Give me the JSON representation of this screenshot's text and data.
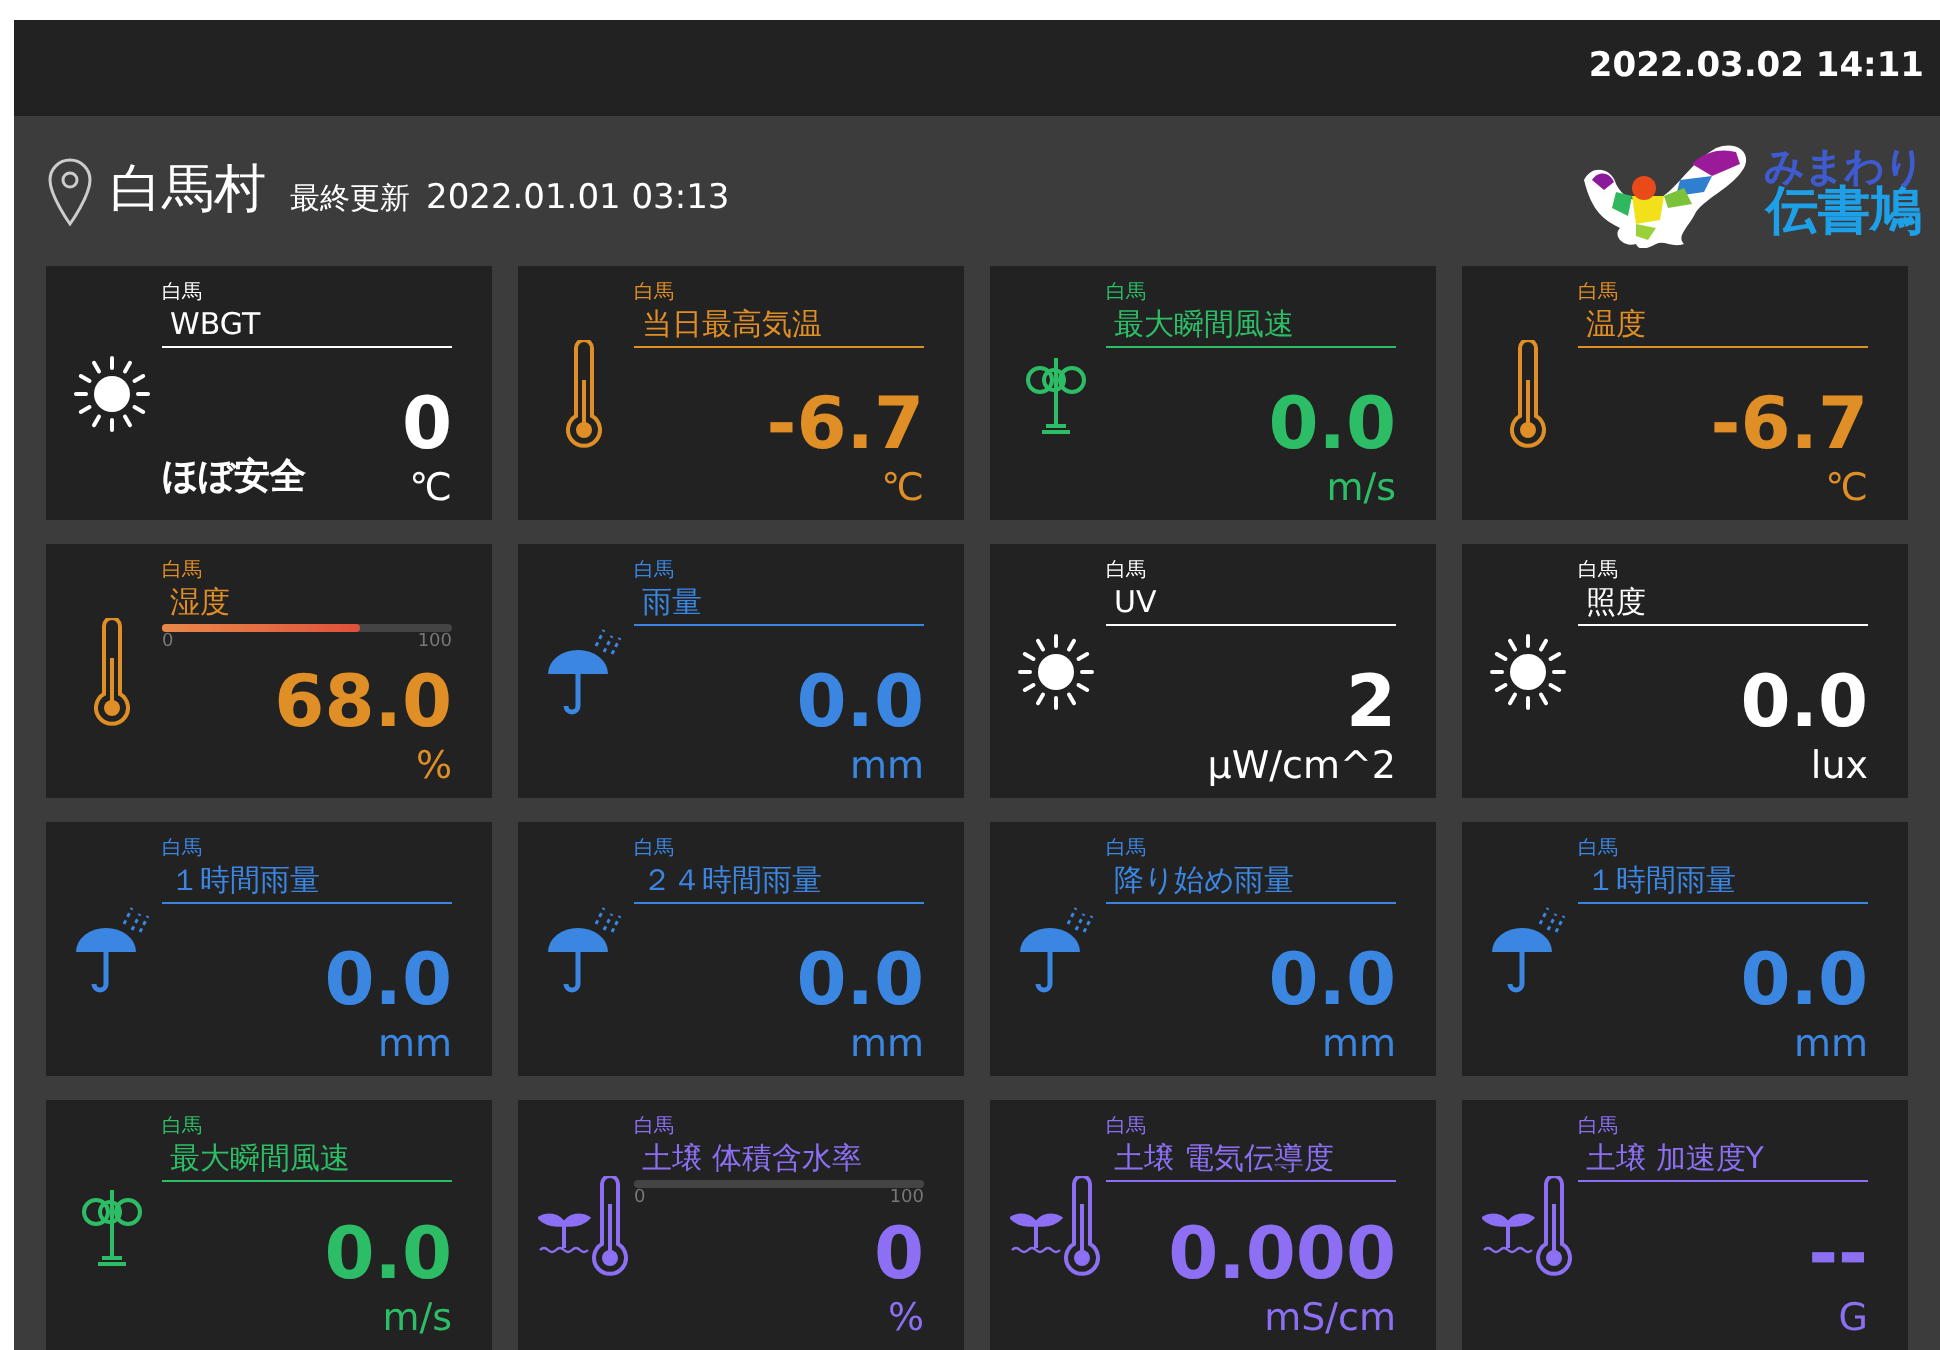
{
  "clock": "2022.03.02 14:11",
  "location": {
    "name": "白馬村",
    "updated_label": "最終更新",
    "updated": "2022.01.01 03:13"
  },
  "logo": {
    "line1": "みまわり",
    "line2": "伝書鳩"
  },
  "cards": [
    {
      "kind": "sun",
      "color": "#ffffff",
      "place": "白馬",
      "title": "WBGT",
      "value": "0",
      "unit": "℃",
      "status": "ほぼ安全"
    },
    {
      "kind": "thermometer",
      "color": "#e08e26",
      "place": "白馬",
      "title": "当日最高気温",
      "value": "-6.7",
      "unit": "℃"
    },
    {
      "kind": "wind",
      "color": "#2dbd66",
      "place": "白馬",
      "title": "最大瞬間風速",
      "value": "0.0",
      "unit": "m/s"
    },
    {
      "kind": "thermometer",
      "color": "#e08e26",
      "place": "白馬",
      "title": "温度",
      "value": "-6.7",
      "unit": "℃"
    },
    {
      "kind": "thermometer",
      "color": "#e08e26",
      "place": "白馬",
      "title": "湿度",
      "value": "68.0",
      "unit": "%",
      "bar": {
        "level": 0.68,
        "min": "0",
        "max": "100"
      }
    },
    {
      "kind": "rain",
      "color": "#3b86e0",
      "place": "白馬",
      "title": "雨量",
      "value": "0.0",
      "unit": "mm"
    },
    {
      "kind": "sun",
      "color": "#ffffff",
      "place": "白馬",
      "title": "UV",
      "value": "2",
      "unit": "μW/cm^2"
    },
    {
      "kind": "sun",
      "color": "#ffffff",
      "place": "白馬",
      "title": "照度",
      "value": "0.0",
      "unit": "lux"
    },
    {
      "kind": "rain",
      "color": "#3b86e0",
      "place": "白馬",
      "title": "１時間雨量",
      "value": "0.0",
      "unit": "mm"
    },
    {
      "kind": "rain",
      "color": "#3b86e0",
      "place": "白馬",
      "title": "２４時間雨量",
      "value": "0.0",
      "unit": "mm"
    },
    {
      "kind": "rain",
      "color": "#3b86e0",
      "place": "白馬",
      "title": "降り始め雨量",
      "value": "0.0",
      "unit": "mm"
    },
    {
      "kind": "rain",
      "color": "#3b86e0",
      "place": "白馬",
      "title": "１時間雨量",
      "value": "0.0",
      "unit": "mm"
    },
    {
      "kind": "wind",
      "color": "#2dbd66",
      "place": "白馬",
      "title": "最大瞬間風速",
      "value": "0.0",
      "unit": "m/s"
    },
    {
      "kind": "soil",
      "color": "#8c6ff2",
      "place": "白馬",
      "title": "土壌 体積含水率",
      "value": "0",
      "unit": "%",
      "bar": {
        "level": 0,
        "min": "0",
        "max": "100"
      }
    },
    {
      "kind": "soil",
      "color": "#8c6ff2",
      "place": "白馬",
      "title": "土壌 電気伝導度",
      "value": "0.000",
      "unit": "mS/cm"
    },
    {
      "kind": "soil",
      "color": "#8c6ff2",
      "place": "白馬",
      "title": "土壌 加速度Y",
      "value": "--",
      "unit": "G"
    }
  ]
}
